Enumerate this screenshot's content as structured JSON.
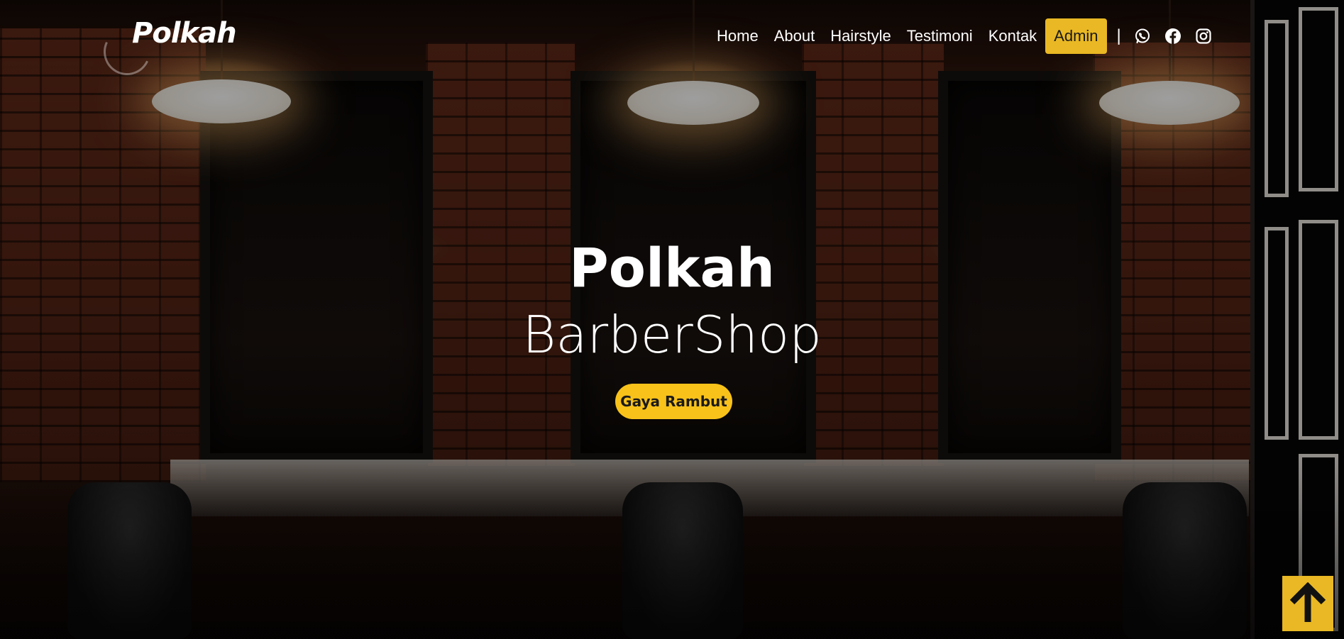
{
  "brand": {
    "logo_text": "Polkah"
  },
  "nav": {
    "items": [
      {
        "label": "Home"
      },
      {
        "label": "About"
      },
      {
        "label": "Hairstyle"
      },
      {
        "label": "Testimoni"
      },
      {
        "label": "Kontak"
      }
    ],
    "admin_label": "Admin",
    "separator": "|",
    "social": [
      "whatsapp-icon",
      "facebook-icon",
      "instagram-icon"
    ]
  },
  "hero": {
    "title": "Polkah",
    "subtitle": "BarberShop",
    "cta_label": "Gaya Rambut"
  },
  "colors": {
    "accent": "#e9b824",
    "cta": "#f8c21a",
    "text": "#ffffff"
  }
}
